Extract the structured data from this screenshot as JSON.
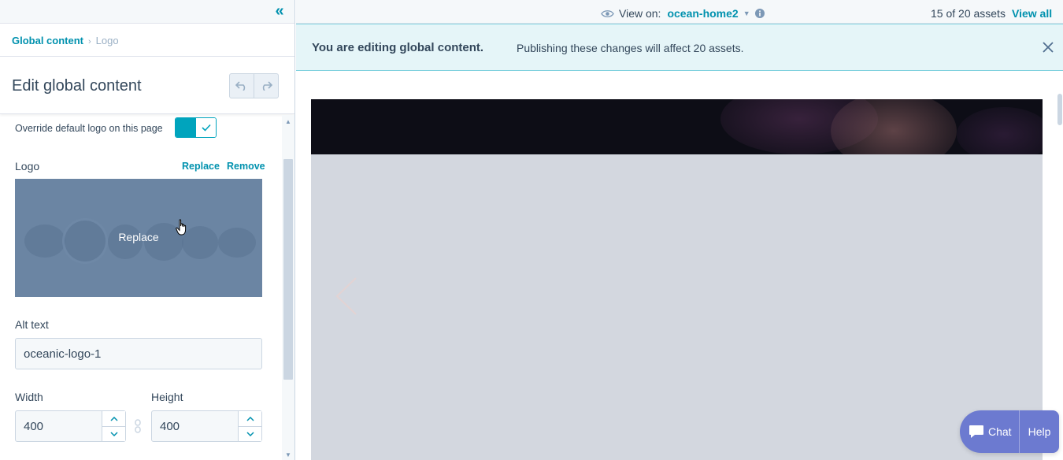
{
  "left_panel": {
    "breadcrumb": {
      "parent": "Global content",
      "current": "Logo"
    },
    "title": "Edit global content",
    "override": {
      "label": "Override default logo on this page",
      "enabled": true
    },
    "logo": {
      "label": "Logo",
      "replace_link": "Replace",
      "remove_link": "Remove",
      "overlay_text": "Replace"
    },
    "alt_text": {
      "label": "Alt text",
      "value": "oceanic-logo-1"
    },
    "width": {
      "label": "Width",
      "value": "400"
    },
    "height": {
      "label": "Height",
      "value": "400"
    }
  },
  "topbar": {
    "view_on_label": "View on:",
    "view_on_page": "ocean-home2",
    "assets_count": "15 of 20 assets",
    "view_all": "View all"
  },
  "alert": {
    "title": "You are editing global content.",
    "message": "Publishing these changes will affect 20 assets."
  },
  "chat": {
    "chat_label": "Chat",
    "help_label": "Help"
  },
  "colors": {
    "accent": "#0091ae",
    "toggle_on": "#00a4bd",
    "alert_bg": "#e5f5f8",
    "chat_bg": "#6c7ad0",
    "text": "#33475b"
  },
  "icons": {
    "collapse": "double-chevron-left-icon",
    "undo": "undo-icon",
    "redo": "redo-icon",
    "check": "check-icon",
    "eye": "eye-icon",
    "info": "info-icon",
    "close": "close-icon",
    "link": "link-icon",
    "chat": "chat-bubble-icon",
    "carousel_prev": "chevron-left-icon"
  }
}
